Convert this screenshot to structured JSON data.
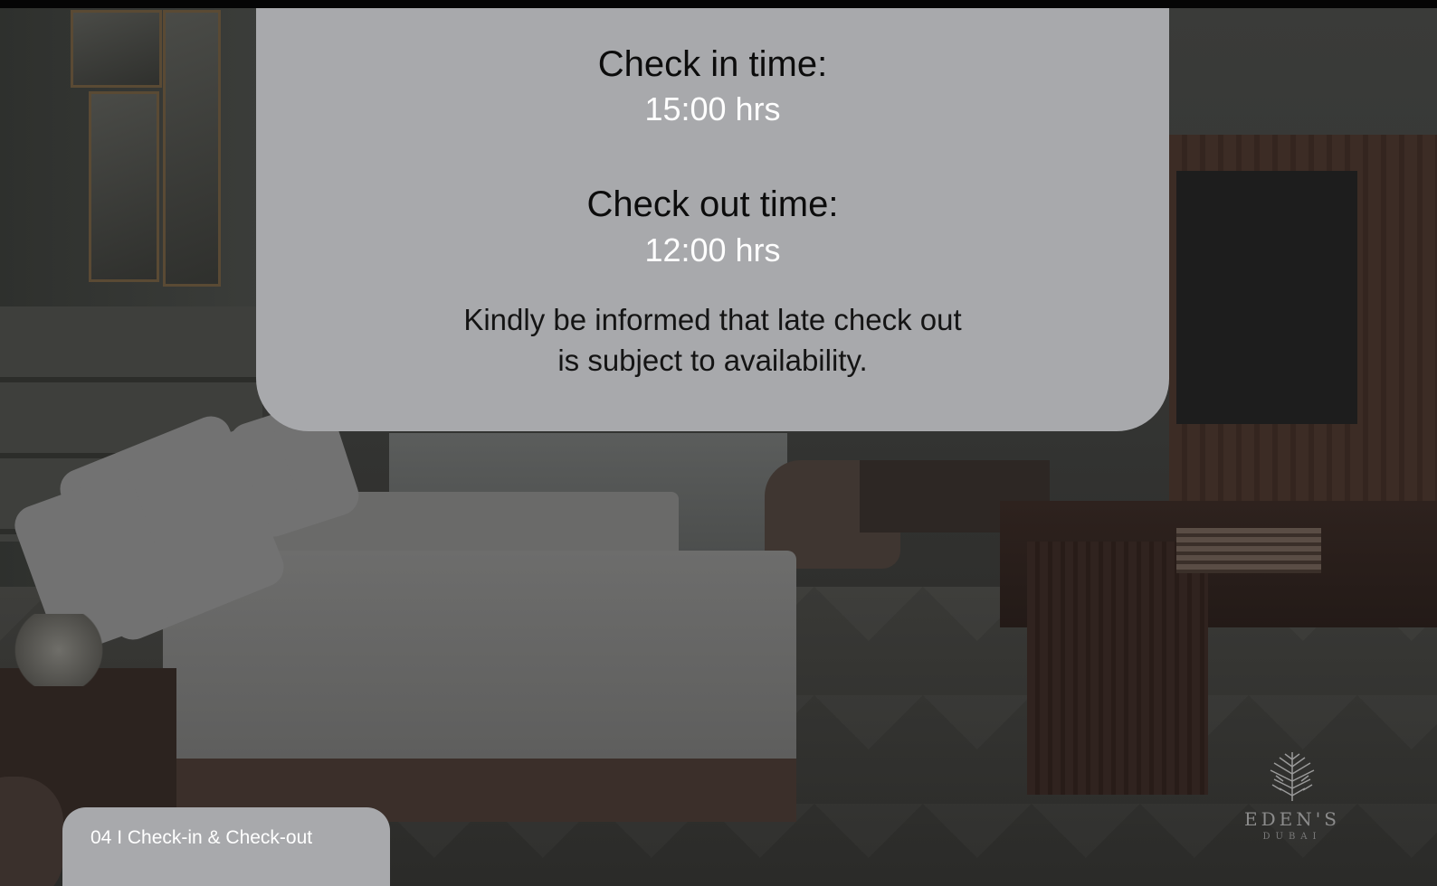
{
  "card": {
    "checkin_heading": "Check in time:",
    "checkin_time": "15:00 hrs",
    "checkout_heading": "Check out time:",
    "checkout_time": "12:00 hrs",
    "note_line1": "Kindly be informed that late check out",
    "note_line2": "is subject to availability."
  },
  "footer": {
    "section_label": "04 I Check-in & Check-out"
  },
  "logo": {
    "name": "EDEN'S",
    "city": "DUBAI",
    "icon": "palm-leaf-icon"
  },
  "colors": {
    "card_background": "#a8a9ac",
    "heading_text": "#0c0c0c",
    "time_text": "#ffffff",
    "page_dark": "#050505"
  }
}
